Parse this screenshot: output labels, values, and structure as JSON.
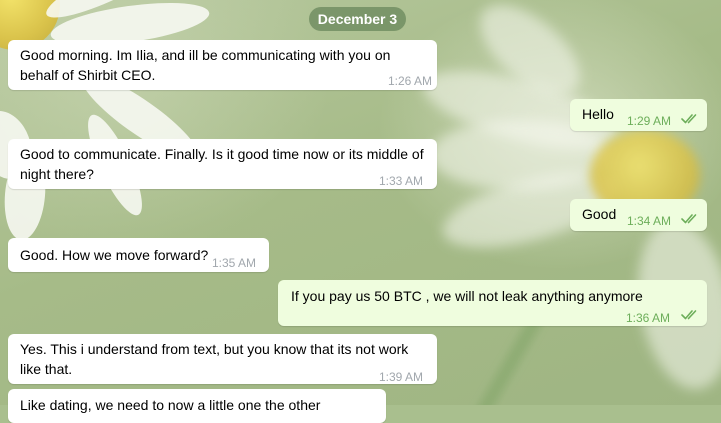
{
  "chat": {
    "date_label": "December 3",
    "messages": [
      {
        "direction": "in",
        "text": "Good morning. Im Ilia, and ill be communicating with you on behalf of Shirbit CEO.",
        "time": "1:26 AM"
      },
      {
        "direction": "out",
        "text": "Hello",
        "time": "1:29 AM",
        "status": "read"
      },
      {
        "direction": "in",
        "text": "Good to communicate. Finally. Is it good time now or its middle of night there?",
        "time": "1:33 AM"
      },
      {
        "direction": "out",
        "text": "Good",
        "time": "1:34 AM",
        "status": "read"
      },
      {
        "direction": "in",
        "text": "Good. How we move forward?",
        "time": "1:35 AM"
      },
      {
        "direction": "out",
        "text": "If you pay us 50 BTC , we will not leak anything anymore",
        "time": "1:36 AM",
        "status": "read"
      },
      {
        "direction": "in",
        "text": "Yes. This i understand from text, but you know that its not work like that.",
        "time": "1:39 AM"
      },
      {
        "direction": "in",
        "text": "Like dating, we need to now a little one the other",
        "time": ""
      }
    ]
  },
  "icons": {
    "read_status": "double-check-icon"
  },
  "colors": {
    "incoming_bubble": "#ffffff",
    "outgoing_bubble": "#effdde",
    "outgoing_time": "#6dae5a",
    "incoming_time": "#a1a7ad",
    "date_pill": "#6f8c60"
  }
}
